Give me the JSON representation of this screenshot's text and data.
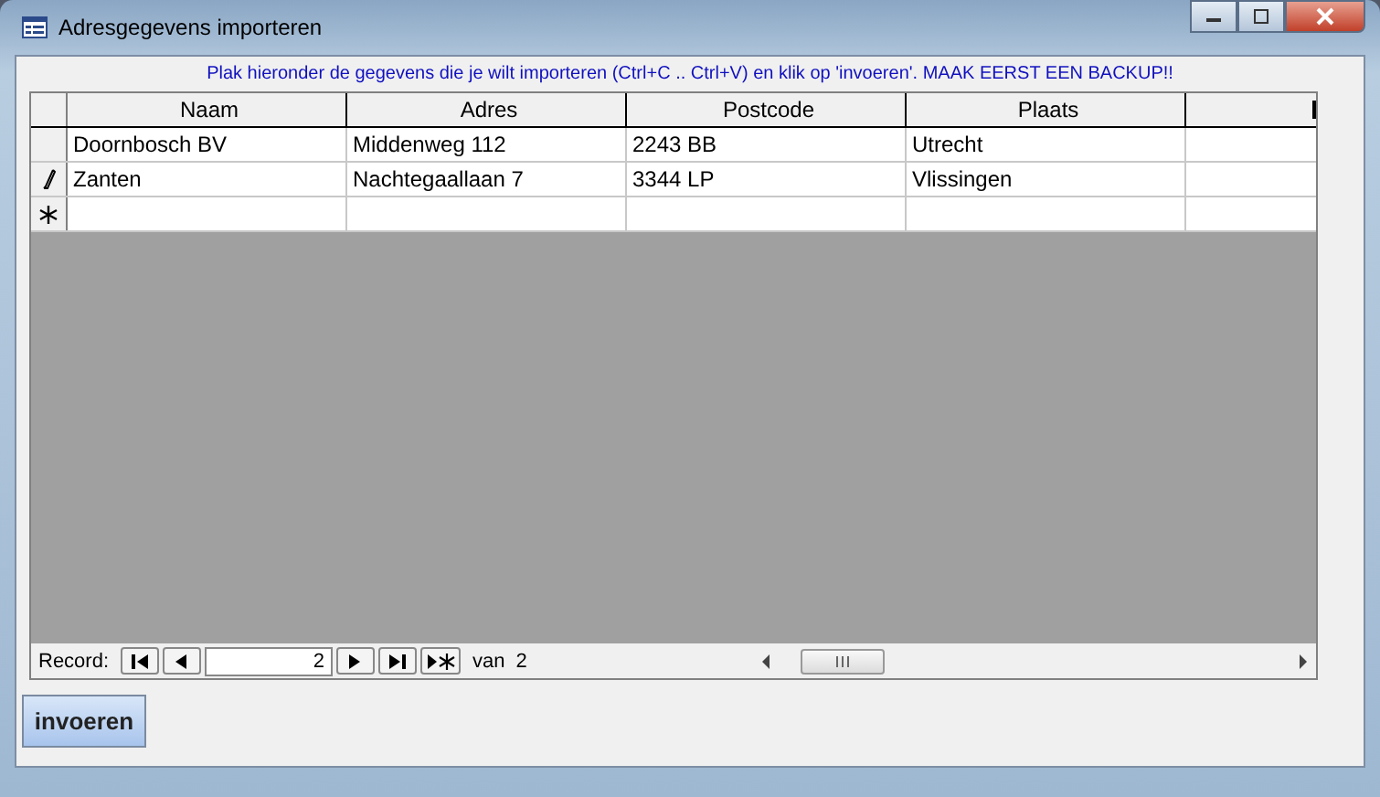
{
  "window": {
    "title": "Adresgegevens importeren"
  },
  "instruction": "Plak hieronder de gegevens die je wilt importeren (Ctrl+C .. Ctrl+V) en klik op 'invoeren'. MAAK EERST EEN BACKUP!!",
  "table": {
    "columns": [
      "Naam",
      "Adres",
      "Postcode",
      "Plaats"
    ],
    "rows": [
      {
        "cells": [
          "Doornbosch BV",
          "Middenweg 112",
          "2243 BB",
          "Utrecht"
        ],
        "editing": false
      },
      {
        "cells": [
          "Zanten",
          "Nachtegaallaan 7",
          "3344 LP",
          "Vlissingen"
        ],
        "editing": true
      }
    ]
  },
  "navigation": {
    "label": "Record:",
    "current": "2",
    "of_label": "van",
    "total": "2"
  },
  "buttons": [
    "invoeren"
  ]
}
